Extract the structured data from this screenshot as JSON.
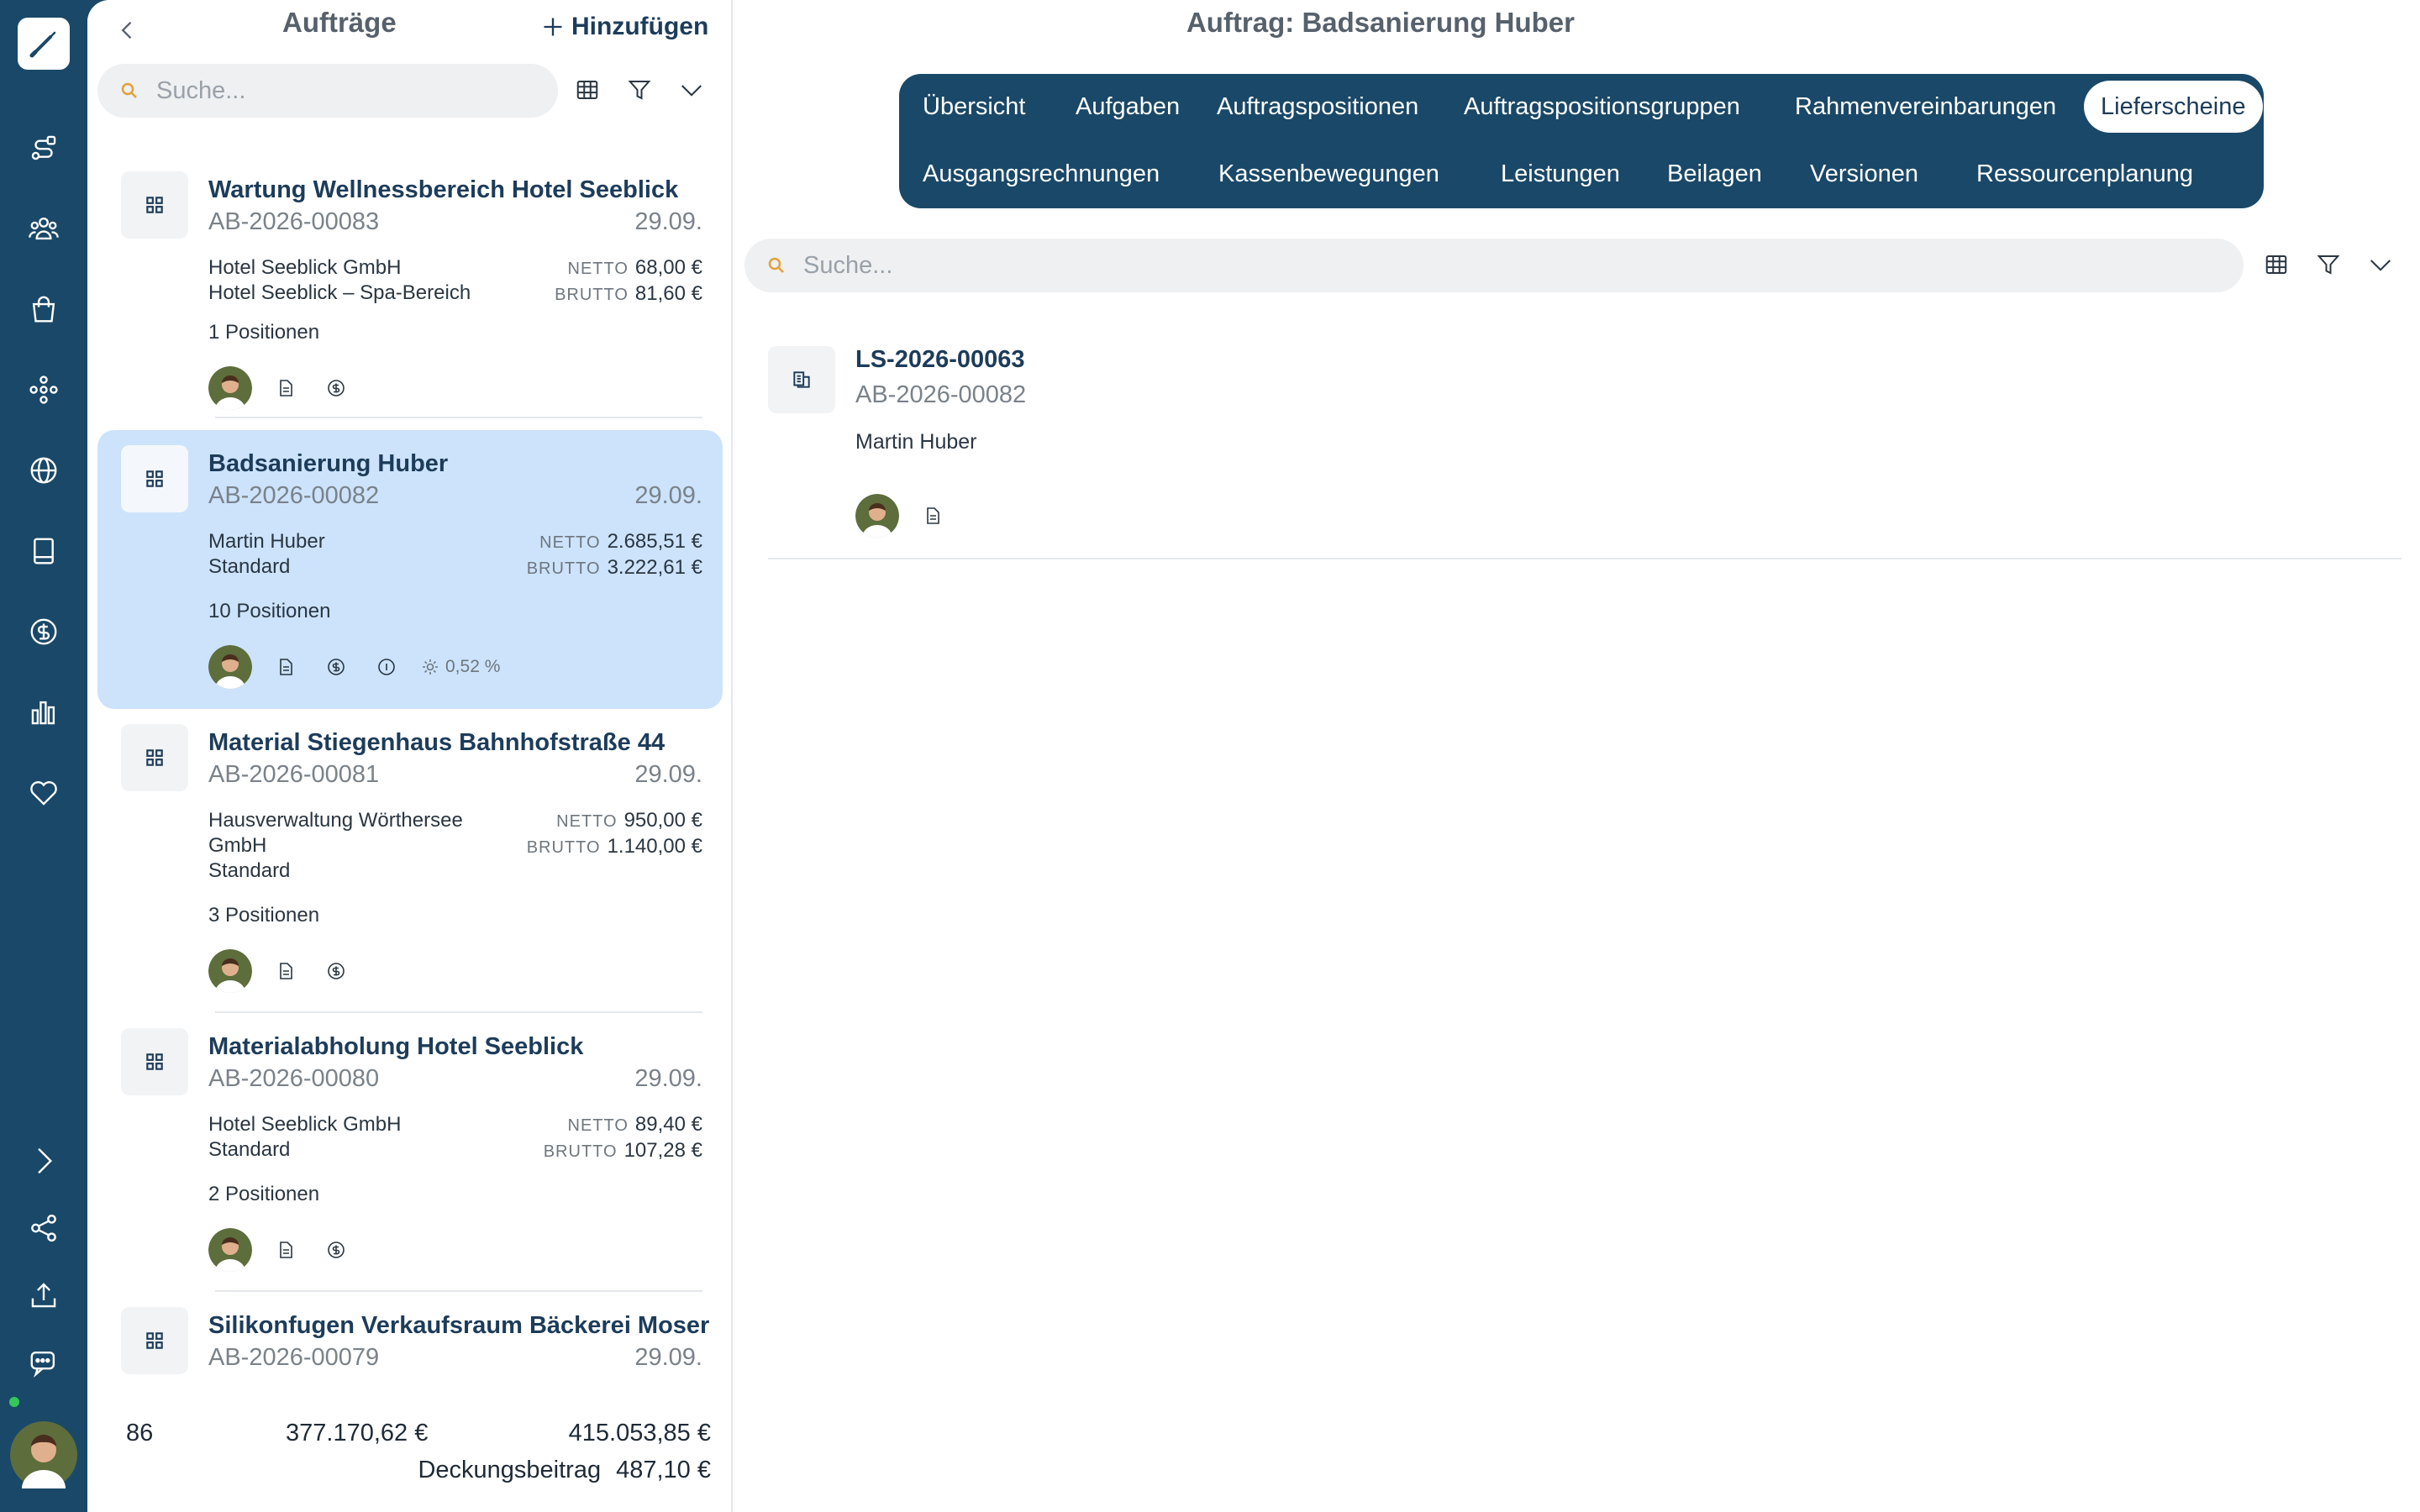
{
  "colors": {
    "rail": "#1a4868",
    "accent": "#1d3c5a",
    "selected": "#cce3fb",
    "online": "#35c759"
  },
  "rail": {
    "items": [
      {
        "name": "route-icon"
      },
      {
        "name": "team-icon"
      },
      {
        "name": "shopping-bag-icon"
      },
      {
        "name": "network-icon"
      },
      {
        "name": "globe-icon"
      },
      {
        "name": "book-icon"
      },
      {
        "name": "dollar-icon"
      },
      {
        "name": "bar-chart-icon"
      },
      {
        "name": "heart-icon"
      }
    ],
    "bottom": [
      {
        "name": "expand-icon"
      },
      {
        "name": "share-icon"
      },
      {
        "name": "upload-icon"
      },
      {
        "name": "chat-icon"
      }
    ]
  },
  "list": {
    "title": "Aufträge",
    "add_label": "Hinzufügen",
    "search_placeholder": "Suche...",
    "cards": [
      {
        "title": "Wartung Wellnessbereich Hotel Seeblick",
        "number": "AB-2026-00083",
        "date": "29.09.",
        "lines": [
          "Hotel Seeblick GmbH",
          "Hotel Seeblick – Spa-Bereich"
        ],
        "netto_label": "NETTO",
        "netto": "68,00 €",
        "brutto_label": "BRUTTO",
        "brutto": "81,60 €",
        "positions": "1 Positionen"
      },
      {
        "title": "Badsanierung Huber",
        "number": "AB-2026-00082",
        "date": "29.09.",
        "lines": [
          "Martin Huber",
          "Standard"
        ],
        "netto_label": "NETTO",
        "netto": "2.685,51 €",
        "brutto_label": "BRUTTO",
        "brutto": "3.222,61 €",
        "positions": "10 Positionen",
        "percent": "0,52 %"
      },
      {
        "title": "Material Stiegenhaus Bahnhofstraße 44",
        "number": "AB-2026-00081",
        "date": "29.09.",
        "lines": [
          "Hausverwaltung Wörthersee",
          "GmbH",
          "Standard"
        ],
        "netto_label": "NETTO",
        "netto": "950,00 €",
        "brutto_label": "BRUTTO",
        "brutto": "1.140,00 €",
        "positions": "3 Positionen"
      },
      {
        "title": "Materialabholung Hotel Seeblick",
        "number": "AB-2026-00080",
        "date": "29.09.",
        "lines": [
          "Hotel Seeblick GmbH",
          "Standard"
        ],
        "netto_label": "NETTO",
        "netto": "89,40 €",
        "brutto_label": "BRUTTO",
        "brutto": "107,28 €",
        "positions": "2 Positionen"
      },
      {
        "title": "Silikonfugen Verkaufsraum Bäckerei Moser",
        "number": "AB-2026-00079",
        "date": "29.09."
      }
    ],
    "summary": {
      "count": "86",
      "netto_total": "377.170,62 €",
      "brutto_total": "415.053,85 €",
      "db_label": "Deckungsbeitrag",
      "db_value": "487,10 €"
    }
  },
  "detail": {
    "title": "Auftrag: Badsanierung Huber",
    "tabs_row1": [
      "Übersicht",
      "Aufgaben",
      "Auftragspositionen",
      "Auftragspositionsgruppen",
      "Rahmenvereinbarungen",
      "Lieferscheine"
    ],
    "tabs_row2": [
      "Ausgangsrechnungen",
      "Kassenbewegungen",
      "Leistungen",
      "Beilagen",
      "Versionen",
      "Ressourcenplanung"
    ],
    "active_tab": "Lieferscheine",
    "search_placeholder": "Suche...",
    "delivery_note": {
      "number": "LS-2026-00063",
      "order": "AB-2026-00082",
      "client": "Martin Huber"
    }
  }
}
